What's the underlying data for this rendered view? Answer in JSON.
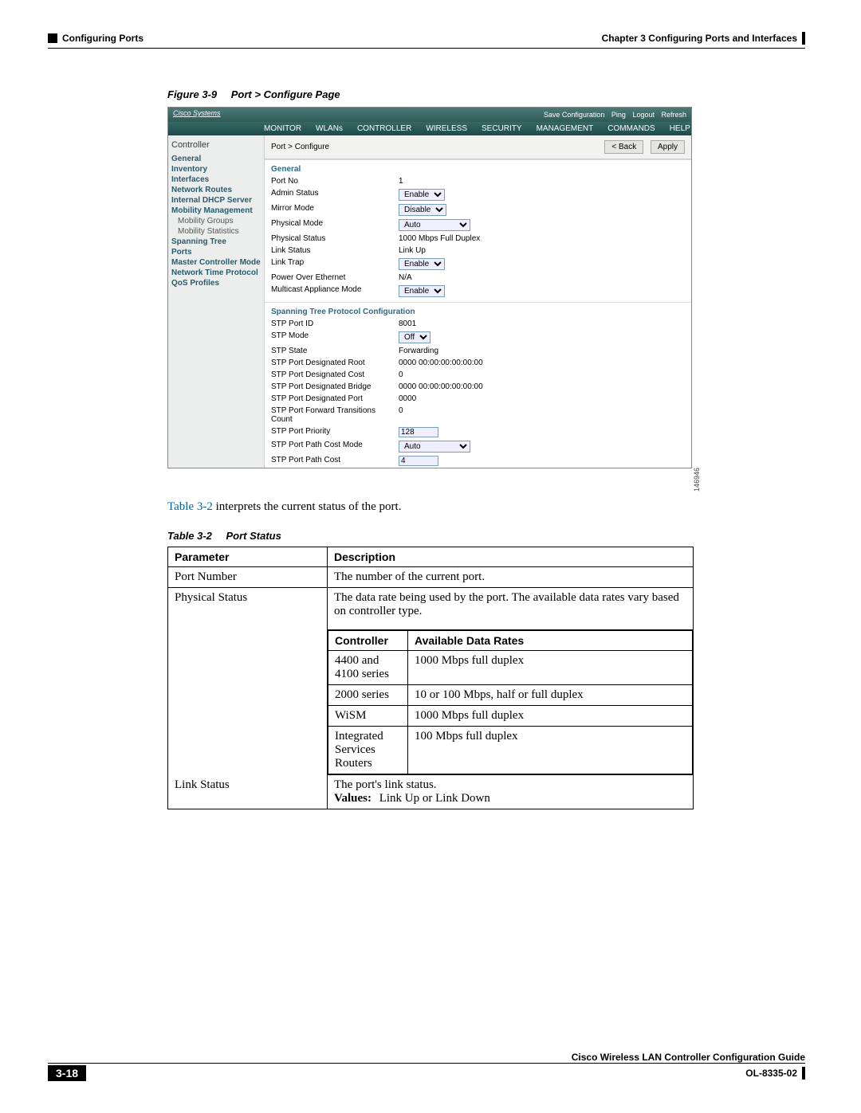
{
  "header": {
    "section": "Configuring Ports",
    "chapter": "Chapter 3      Configuring Ports and Interfaces"
  },
  "figure": {
    "label": "Figure 3-9",
    "title": "Port > Configure Page"
  },
  "screenshot": {
    "brand": "Cisco Systems",
    "topright": [
      "Save Configuration",
      "Ping",
      "Logout",
      "Refresh"
    ],
    "menu": [
      "MONITOR",
      "WLANs",
      "CONTROLLER",
      "WIRELESS",
      "SECURITY",
      "MANAGEMENT",
      "COMMANDS",
      "HELP"
    ],
    "side_title": "Controller",
    "side": {
      "links": [
        "General",
        "Inventory",
        "Interfaces",
        "Network Routes",
        "Internal DHCP Server",
        "Mobility Management",
        "Mobility Groups",
        "Mobility Statistics",
        "Spanning Tree",
        "Ports",
        "Master Controller Mode",
        "Network Time Protocol",
        "QoS Profiles"
      ]
    },
    "breadcrumb": "Port > Configure",
    "btn_back": "< Back",
    "btn_apply": "Apply",
    "section_general": "General",
    "general": [
      {
        "k": "Port No",
        "v": "1"
      },
      {
        "k": "Admin Status",
        "v": "Enable",
        "sel": true
      },
      {
        "k": "Mirror Mode",
        "v": "Disable",
        "sel": true
      },
      {
        "k": "Physical Mode",
        "v": "Auto",
        "sel": true,
        "wide": true
      },
      {
        "k": "Physical Status",
        "v": "1000 Mbps Full Duplex"
      },
      {
        "k": "Link Status",
        "v": "Link Up"
      },
      {
        "k": "Link Trap",
        "v": "Enable",
        "sel": true
      },
      {
        "k": "Power Over Ethernet",
        "v": "N/A"
      },
      {
        "k": "Multicast Appliance Mode",
        "v": "Enable",
        "sel": true
      }
    ],
    "section_stp": "Spanning Tree Protocol Configuration",
    "stp": [
      {
        "k": "STP Port ID",
        "v": "8001"
      },
      {
        "k": "STP Mode",
        "v": "Off",
        "sel": true
      },
      {
        "k": "STP State",
        "v": "Forwarding"
      },
      {
        "k": "STP Port Designated Root",
        "v": "0000 00:00:00:00:00:00"
      },
      {
        "k": "STP Port Designated Cost",
        "v": "0"
      },
      {
        "k": "STP Port Designated Bridge",
        "v": "0000 00:00:00:00:00:00"
      },
      {
        "k": "STP Port Designated Port",
        "v": "0000"
      },
      {
        "k": "STP Port Forward Transitions Count",
        "v": "0"
      },
      {
        "k": "STP Port Priority",
        "v": "128",
        "inp": true
      },
      {
        "k": "STP Port Path Cost Mode",
        "v": "Auto",
        "sel": true,
        "wide": true
      },
      {
        "k": "STP Port Path Cost",
        "v": "4",
        "inp": true
      }
    ],
    "image_id": "146946"
  },
  "body_sentence_link": "Table 3-2",
  "body_sentence_rest": " interprets the current status of the port.",
  "table": {
    "label": "Table 3-2",
    "title": "Port Status",
    "head_param": "Parameter",
    "head_desc": "Description",
    "row_port_num_param": "Port Number",
    "row_port_num_desc": "The number of the current port.",
    "row_phys_param": "Physical Status",
    "row_phys_desc": "The data rate being used by the port. The available data rates vary based on controller type.",
    "inner_head_ctrl": "Controller",
    "inner_head_rates": "Available Data Rates",
    "inner_rows": [
      {
        "c": "4400 and 4100 series",
        "r": "1000 Mbps full duplex"
      },
      {
        "c": "2000 series",
        "r": "10 or 100 Mbps, half or full duplex"
      },
      {
        "c": "WiSM",
        "r": "1000 Mbps full duplex"
      },
      {
        "c": "Integrated Services Routers",
        "r": "100 Mbps full duplex"
      }
    ],
    "row_link_param": "Link Status",
    "row_link_desc": "The port's link status.",
    "row_link_values_label": "Values:",
    "row_link_values_text": "  Link Up or Link Down"
  },
  "footer": {
    "guide": "Cisco Wireless LAN Controller Configuration Guide",
    "page": "3-18",
    "doc": "OL-8335-02"
  }
}
